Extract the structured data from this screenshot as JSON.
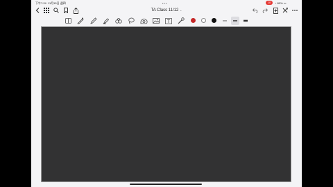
{
  "status": {
    "time": "下午7:24",
    "date": "11月15日 週四",
    "record": "10",
    "battery": "80%"
  },
  "nav": {
    "title": "TA Class 11/12",
    "title_chevron": "⌄"
  },
  "toolbar": {
    "colors": [
      "#c62828",
      "#ffffff",
      "#111111"
    ],
    "stroke_widths": [
      "thin",
      "medium",
      "thick"
    ],
    "selected_stroke": "medium",
    "text_tool_glyph": "T"
  },
  "colors": {
    "accent": "#3a6fd8",
    "canvas": "#323233",
    "chrome": "#f4f4f6"
  }
}
